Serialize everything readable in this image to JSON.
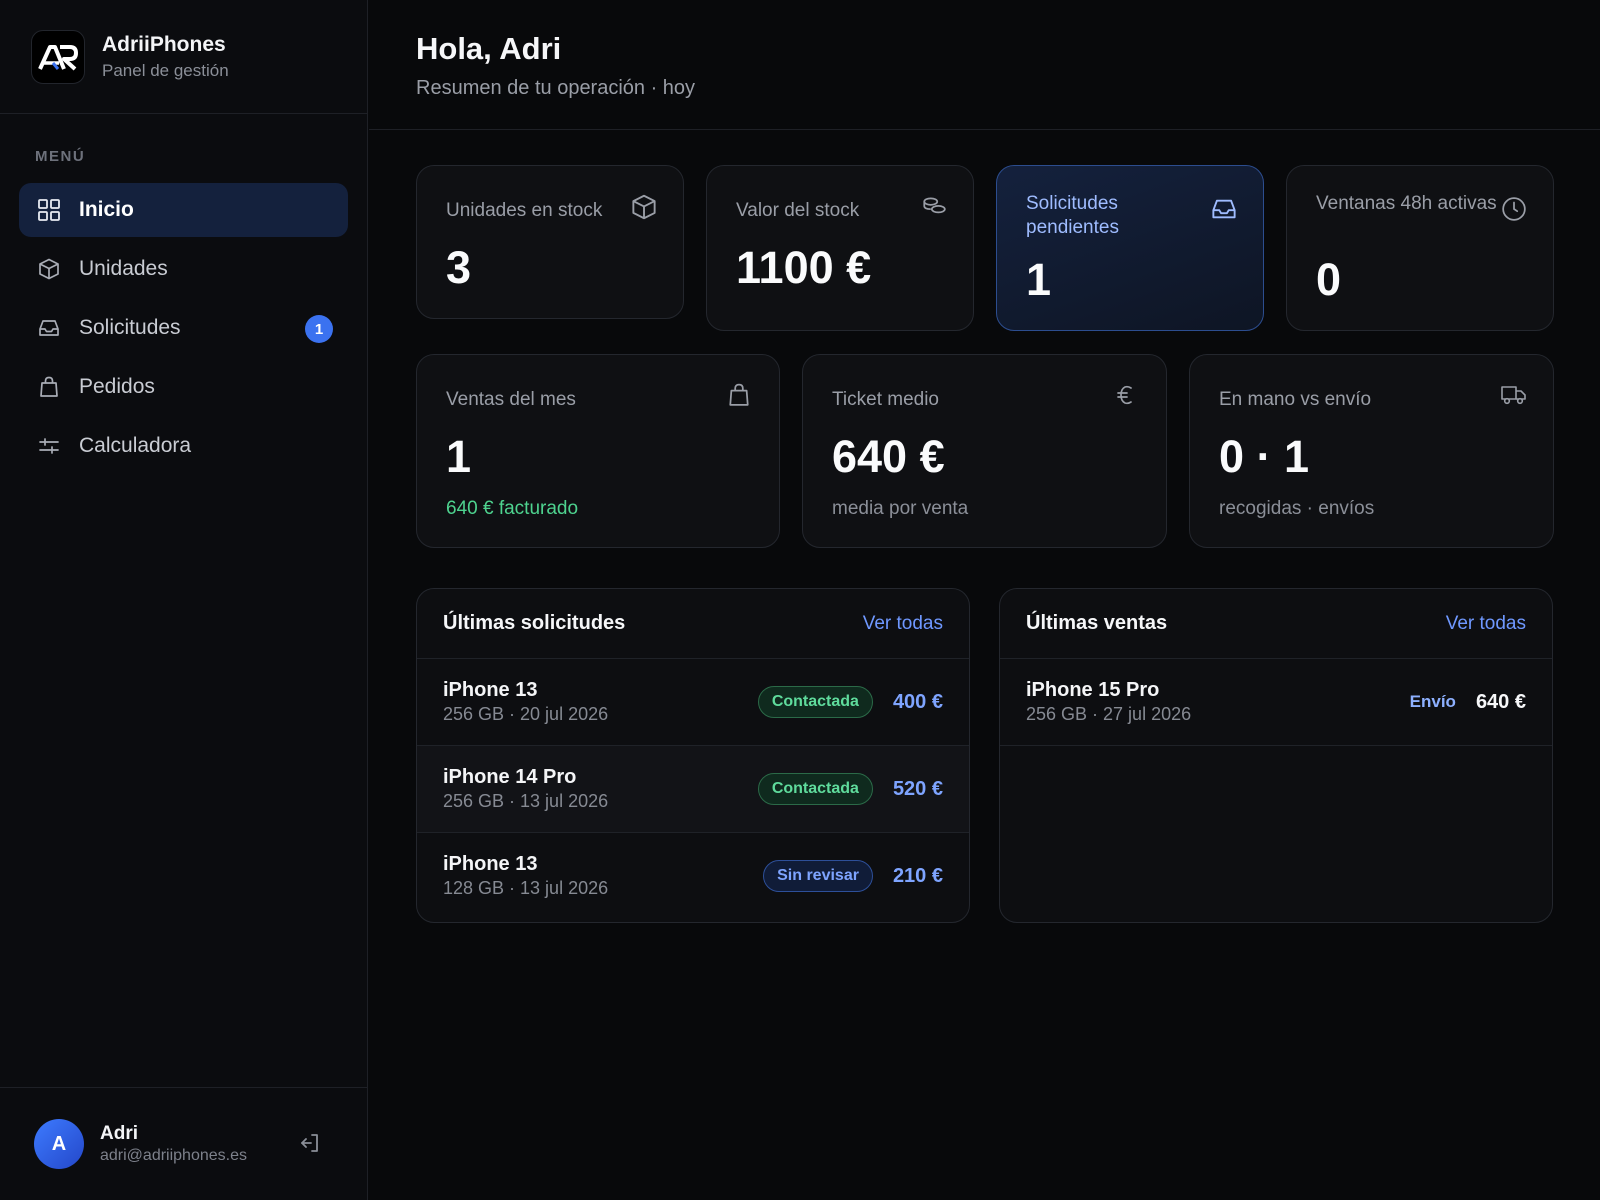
{
  "brand": {
    "name": "AdriiPhones",
    "subtitle": "Panel de gestión",
    "logo_text": "AR"
  },
  "menu_label": "MENÚ",
  "nav": [
    {
      "label": "Inicio",
      "icon": "grid-icon",
      "active": true
    },
    {
      "label": "Unidades",
      "icon": "box-icon"
    },
    {
      "label": "Solicitudes",
      "icon": "inbox-icon",
      "badge": "1"
    },
    {
      "label": "Pedidos",
      "icon": "bag-icon"
    },
    {
      "label": "Calculadora",
      "icon": "sliders-icon"
    }
  ],
  "user": {
    "initial": "A",
    "name": "Adri",
    "email": "adri@adriiphones.es"
  },
  "header": {
    "greeting": "Hola, Adri",
    "subtitle": "Resumen de tu operación · hoy"
  },
  "stats_top": [
    {
      "label": "Unidades en stock",
      "value": "3",
      "icon": "box-icon"
    },
    {
      "label": "Valor del stock",
      "value": "1100 €",
      "icon": "coins-icon"
    },
    {
      "label": "Solicitudes pendientes",
      "value": "1",
      "icon": "inbox-icon",
      "highlight": true
    },
    {
      "label": "Ventanas 48h activas",
      "value": "0",
      "icon": "clock-icon"
    }
  ],
  "stats_bottom": [
    {
      "label": "Ventas del mes",
      "value": "1",
      "note": "640 € facturado",
      "icon": "bag-icon",
      "accent": "#4ed38f"
    },
    {
      "label": "Ticket medio",
      "value": "640 €",
      "note": "media por venta",
      "icon": "euro-icon"
    },
    {
      "label": "En mano vs envío",
      "value": "0 · 1",
      "note": "recogidas · envíos",
      "icon": "truck-icon"
    }
  ],
  "requests": {
    "title": "Últimas solicitudes",
    "link": "Ver todas",
    "rows": [
      {
        "model": "iPhone 13",
        "detail": "256 GB · 20 jul 2026",
        "status": "Contactada",
        "price": "400 €"
      },
      {
        "model": "iPhone 14 Pro",
        "detail": "256 GB · 13 jul 2026",
        "status": "Contactada",
        "price": "520 €"
      },
      {
        "model": "iPhone 13",
        "detail": "128 GB · 13 jul 2026",
        "status": "Sin revisar",
        "price": "210 €"
      }
    ]
  },
  "sales": {
    "title": "Últimas ventas",
    "link": "Ver todas",
    "rows": [
      {
        "model": "iPhone 15 Pro",
        "detail": "256 GB · 27 jul 2026",
        "method": "Envío",
        "price": "640 €"
      }
    ]
  },
  "colors": {
    "accent": "#3b72f0",
    "success": "#4ed38f",
    "link": "#6f98ff",
    "background": "#08090b"
  }
}
